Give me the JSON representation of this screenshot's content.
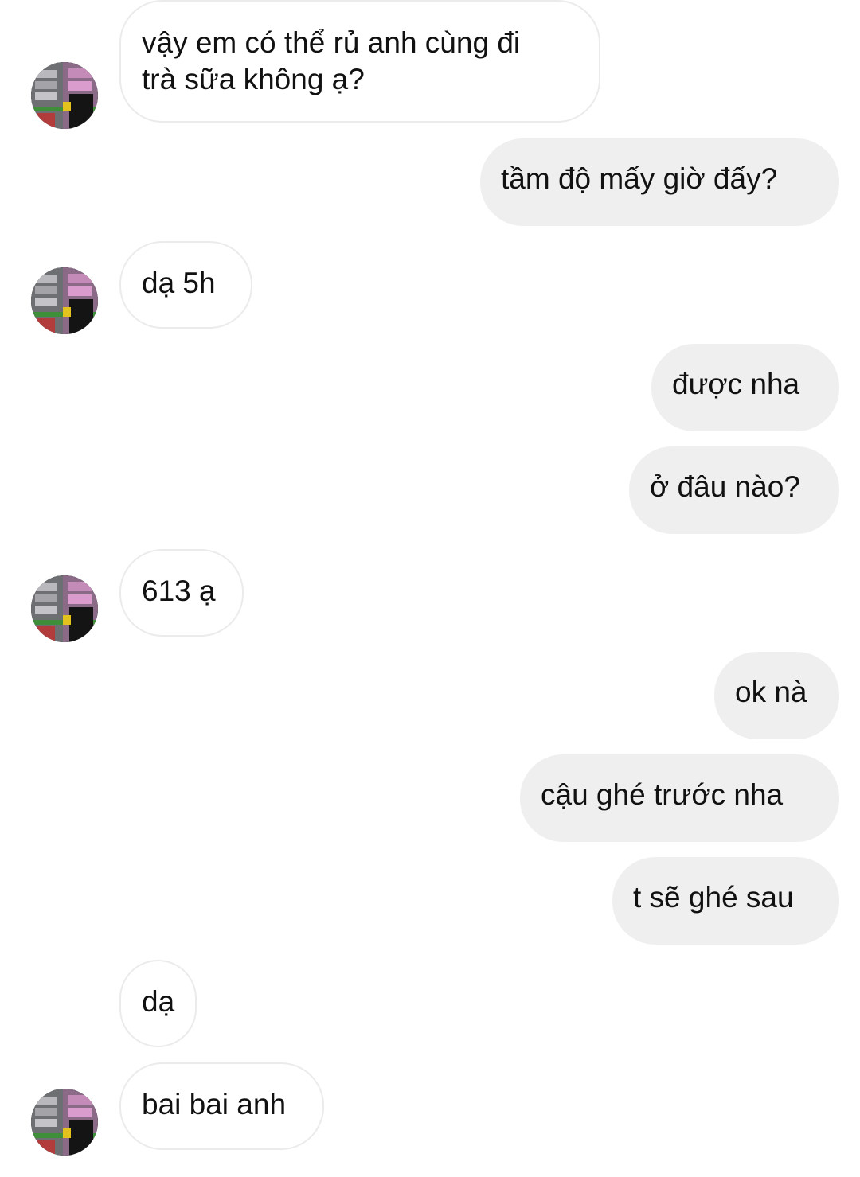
{
  "messages": [
    {
      "sender": "them",
      "lines": [
        "vậy em có thể rủ anh cùng đi",
        "trà sữa không ạ?"
      ]
    },
    {
      "sender": "me",
      "text": "tầm độ mấy giờ đấy?"
    },
    {
      "sender": "them",
      "text": "dạ 5h"
    },
    {
      "sender": "me",
      "text": "được nha"
    },
    {
      "sender": "me",
      "text": "ở đâu nào?"
    },
    {
      "sender": "them",
      "text": "613 ạ"
    },
    {
      "sender": "me",
      "text": "ok nà"
    },
    {
      "sender": "me",
      "text": "cậu ghé trước nha"
    },
    {
      "sender": "me",
      "text": "t sẽ ghé sau"
    },
    {
      "sender": "them",
      "text": "dạ"
    },
    {
      "sender": "them",
      "text": "bai bai anh"
    }
  ],
  "colors": {
    "incoming_bubble": "#ffffff",
    "incoming_border": "#ebebeb",
    "outgoing_bubble": "#efefef",
    "text": "#111111"
  },
  "icons": {
    "avatar": "contact-avatar-photo"
  }
}
